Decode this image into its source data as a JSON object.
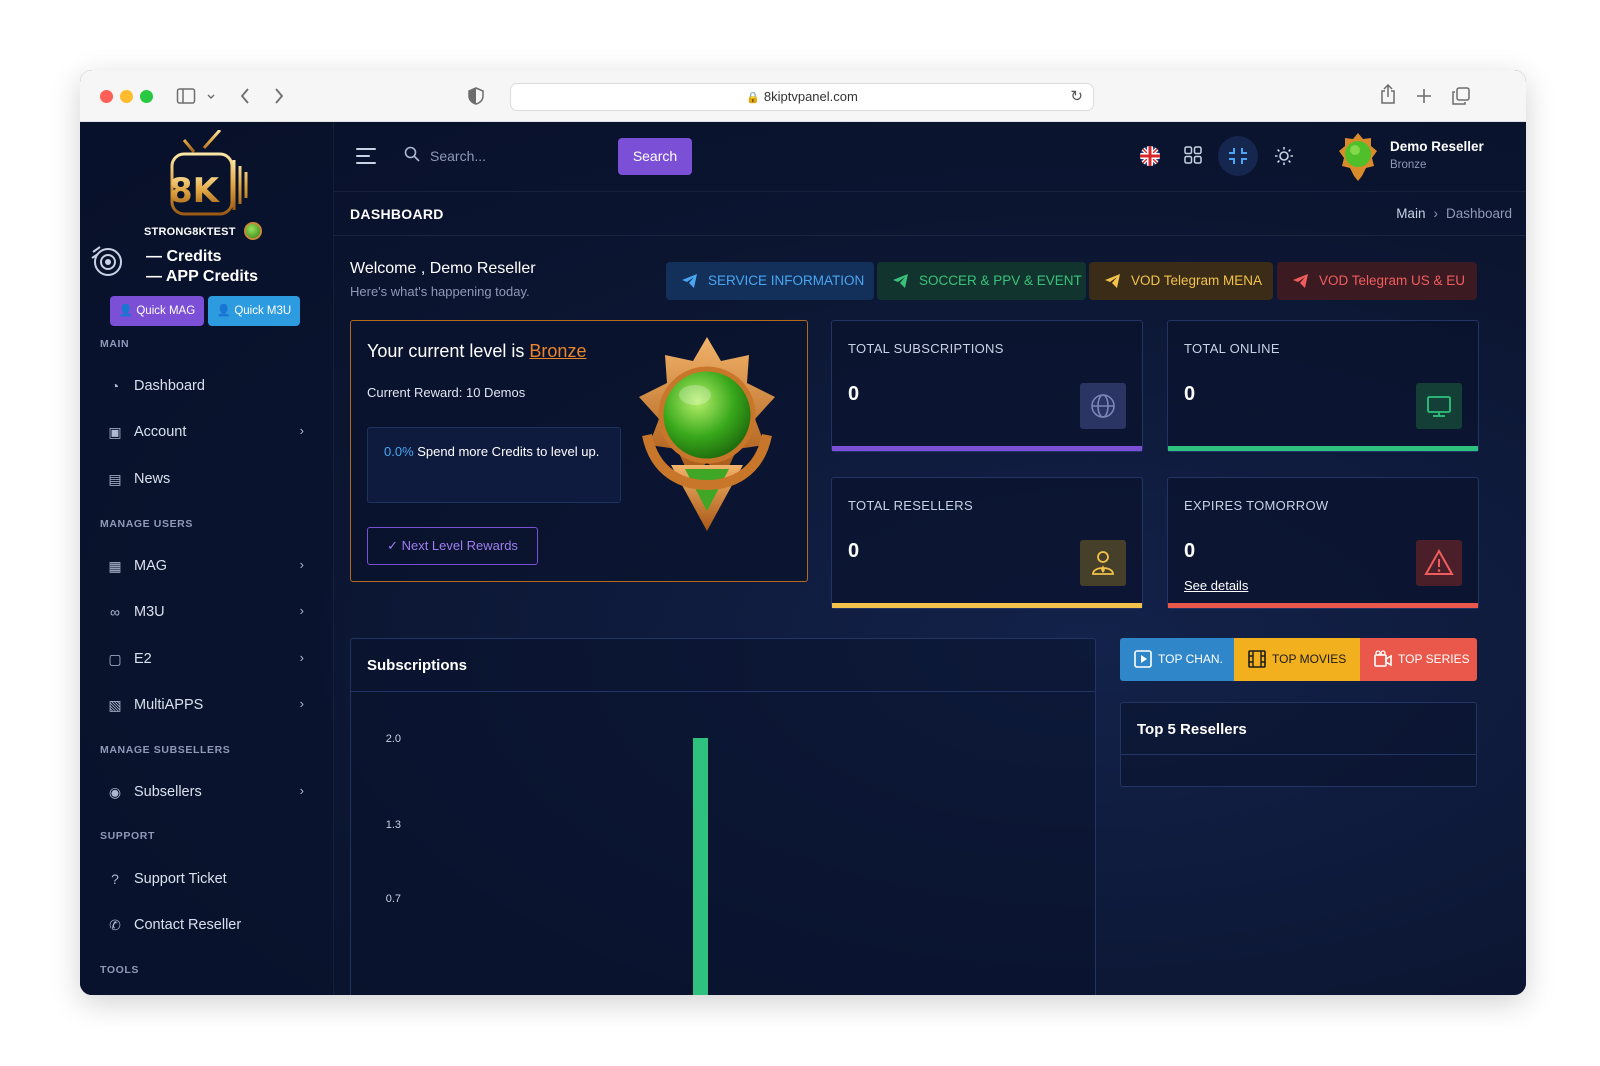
{
  "browser": {
    "url": "8kiptvpanel.com"
  },
  "brand": {
    "name": "STRONG8KTEST",
    "credits_label": "— Credits",
    "app_credits_label": "— APP Credits"
  },
  "quick": {
    "mag": "Quick MAG",
    "m3u": "Quick M3U"
  },
  "sidebar": {
    "sections": {
      "main": "MAIN",
      "manage_users": "MANAGE USERS",
      "manage_subsellers": "MANAGE SUBSELLERS",
      "support": "SUPPORT",
      "tools": "TOOLS"
    },
    "items": {
      "dashboard": "Dashboard",
      "account": "Account",
      "news": "News",
      "mag": "MAG",
      "m3u": "M3U",
      "e2": "E2",
      "multiapps": "MultiAPPS",
      "subsellers": "Subsellers",
      "support_ticket": "Support Ticket",
      "contact_reseller": "Contact Reseller"
    }
  },
  "header": {
    "search_placeholder": "Search...",
    "search_button": "Search",
    "user_name": "Demo Reseller",
    "user_level": "Bronze"
  },
  "page": {
    "title": "DASHBOARD",
    "breadcrumb_main": "Main",
    "breadcrumb_sep": "›",
    "breadcrumb_current": "Dashboard"
  },
  "welcome": {
    "title": "Welcome , Demo Reseller",
    "subtitle": "Here's what's happening today."
  },
  "telegram": {
    "service": "SERVICE INFORMATION",
    "soccer": "SOCCER & PPV & EVENT",
    "vod_mena": "VOD Telegram MENA",
    "vod_us": "VOD Telegram US & EU"
  },
  "level": {
    "title_prefix": "Your current level is ",
    "level_name": "Bronze",
    "reward": "Current Reward: 10 Demos",
    "progress_pct": "0.0%",
    "progress_text": " Spend more Credits to level up.",
    "next_button": "Next Level Rewards"
  },
  "stats": {
    "subscriptions": {
      "title": "TOTAL SUBSCRIPTIONS",
      "value": "0"
    },
    "online": {
      "title": "TOTAL ONLINE",
      "value": "0"
    },
    "resellers": {
      "title": "TOTAL RESELLERS",
      "value": "0"
    },
    "expires": {
      "title": "EXPIRES TOMORROW",
      "value": "0",
      "link": "See details"
    }
  },
  "subscriptions": {
    "title": "Subscriptions"
  },
  "top_tabs": {
    "channels": "TOP CHAN.",
    "movies": "TOP MOVIES",
    "series": "TOP SERIES"
  },
  "top_resellers": {
    "title": "Top 5 Resellers"
  },
  "colors": {
    "accent": "#7b4fd6",
    "blue": "#2d9be0",
    "green": "#2ec27e",
    "yellow": "#f2c24b",
    "red": "#e9584a",
    "bronze": "#e9862b"
  },
  "chart_data": {
    "type": "bar",
    "title": "Subscriptions",
    "y_ticks": [
      "2.0",
      "1.3",
      "0.7"
    ],
    "ylim": [
      0,
      2
    ],
    "series": [
      {
        "values": [
          2
        ]
      }
    ],
    "bar_color": "#2ec27e"
  }
}
